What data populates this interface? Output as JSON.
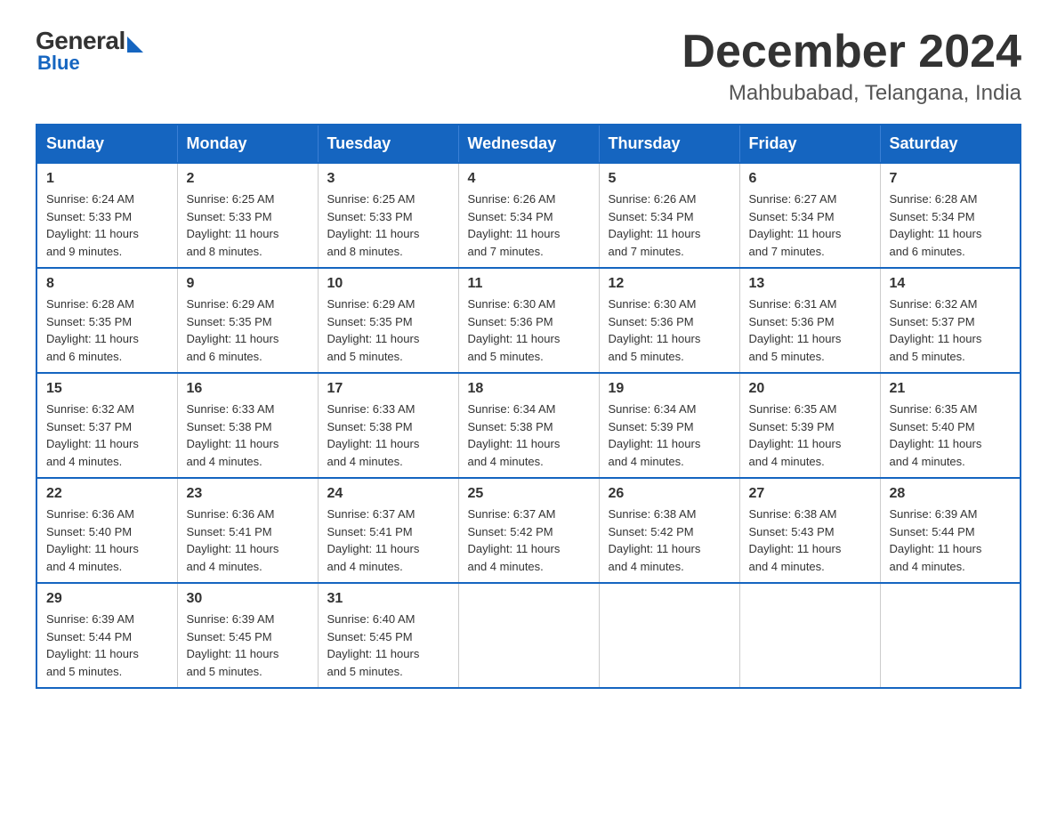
{
  "logo": {
    "general": "General",
    "blue": "Blue",
    "arrow": "▶"
  },
  "title": "December 2024",
  "subtitle": "Mahbubabad, Telangana, India",
  "days": [
    "Sunday",
    "Monday",
    "Tuesday",
    "Wednesday",
    "Thursday",
    "Friday",
    "Saturday"
  ],
  "weeks": [
    [
      {
        "day": "1",
        "sunrise": "6:24 AM",
        "sunset": "5:33 PM",
        "daylight": "11 hours and 9 minutes."
      },
      {
        "day": "2",
        "sunrise": "6:25 AM",
        "sunset": "5:33 PM",
        "daylight": "11 hours and 8 minutes."
      },
      {
        "day": "3",
        "sunrise": "6:25 AM",
        "sunset": "5:33 PM",
        "daylight": "11 hours and 8 minutes."
      },
      {
        "day": "4",
        "sunrise": "6:26 AM",
        "sunset": "5:34 PM",
        "daylight": "11 hours and 7 minutes."
      },
      {
        "day": "5",
        "sunrise": "6:26 AM",
        "sunset": "5:34 PM",
        "daylight": "11 hours and 7 minutes."
      },
      {
        "day": "6",
        "sunrise": "6:27 AM",
        "sunset": "5:34 PM",
        "daylight": "11 hours and 7 minutes."
      },
      {
        "day": "7",
        "sunrise": "6:28 AM",
        "sunset": "5:34 PM",
        "daylight": "11 hours and 6 minutes."
      }
    ],
    [
      {
        "day": "8",
        "sunrise": "6:28 AM",
        "sunset": "5:35 PM",
        "daylight": "11 hours and 6 minutes."
      },
      {
        "day": "9",
        "sunrise": "6:29 AM",
        "sunset": "5:35 PM",
        "daylight": "11 hours and 6 minutes."
      },
      {
        "day": "10",
        "sunrise": "6:29 AM",
        "sunset": "5:35 PM",
        "daylight": "11 hours and 5 minutes."
      },
      {
        "day": "11",
        "sunrise": "6:30 AM",
        "sunset": "5:36 PM",
        "daylight": "11 hours and 5 minutes."
      },
      {
        "day": "12",
        "sunrise": "6:30 AM",
        "sunset": "5:36 PM",
        "daylight": "11 hours and 5 minutes."
      },
      {
        "day": "13",
        "sunrise": "6:31 AM",
        "sunset": "5:36 PM",
        "daylight": "11 hours and 5 minutes."
      },
      {
        "day": "14",
        "sunrise": "6:32 AM",
        "sunset": "5:37 PM",
        "daylight": "11 hours and 5 minutes."
      }
    ],
    [
      {
        "day": "15",
        "sunrise": "6:32 AM",
        "sunset": "5:37 PM",
        "daylight": "11 hours and 4 minutes."
      },
      {
        "day": "16",
        "sunrise": "6:33 AM",
        "sunset": "5:38 PM",
        "daylight": "11 hours and 4 minutes."
      },
      {
        "day": "17",
        "sunrise": "6:33 AM",
        "sunset": "5:38 PM",
        "daylight": "11 hours and 4 minutes."
      },
      {
        "day": "18",
        "sunrise": "6:34 AM",
        "sunset": "5:38 PM",
        "daylight": "11 hours and 4 minutes."
      },
      {
        "day": "19",
        "sunrise": "6:34 AM",
        "sunset": "5:39 PM",
        "daylight": "11 hours and 4 minutes."
      },
      {
        "day": "20",
        "sunrise": "6:35 AM",
        "sunset": "5:39 PM",
        "daylight": "11 hours and 4 minutes."
      },
      {
        "day": "21",
        "sunrise": "6:35 AM",
        "sunset": "5:40 PM",
        "daylight": "11 hours and 4 minutes."
      }
    ],
    [
      {
        "day": "22",
        "sunrise": "6:36 AM",
        "sunset": "5:40 PM",
        "daylight": "11 hours and 4 minutes."
      },
      {
        "day": "23",
        "sunrise": "6:36 AM",
        "sunset": "5:41 PM",
        "daylight": "11 hours and 4 minutes."
      },
      {
        "day": "24",
        "sunrise": "6:37 AM",
        "sunset": "5:41 PM",
        "daylight": "11 hours and 4 minutes."
      },
      {
        "day": "25",
        "sunrise": "6:37 AM",
        "sunset": "5:42 PM",
        "daylight": "11 hours and 4 minutes."
      },
      {
        "day": "26",
        "sunrise": "6:38 AM",
        "sunset": "5:42 PM",
        "daylight": "11 hours and 4 minutes."
      },
      {
        "day": "27",
        "sunrise": "6:38 AM",
        "sunset": "5:43 PM",
        "daylight": "11 hours and 4 minutes."
      },
      {
        "day": "28",
        "sunrise": "6:39 AM",
        "sunset": "5:44 PM",
        "daylight": "11 hours and 4 minutes."
      }
    ],
    [
      {
        "day": "29",
        "sunrise": "6:39 AM",
        "sunset": "5:44 PM",
        "daylight": "11 hours and 5 minutes."
      },
      {
        "day": "30",
        "sunrise": "6:39 AM",
        "sunset": "5:45 PM",
        "daylight": "11 hours and 5 minutes."
      },
      {
        "day": "31",
        "sunrise": "6:40 AM",
        "sunset": "5:45 PM",
        "daylight": "11 hours and 5 minutes."
      },
      null,
      null,
      null,
      null
    ]
  ],
  "labels": {
    "sunrise": "Sunrise:",
    "sunset": "Sunset:",
    "daylight": "Daylight:"
  }
}
